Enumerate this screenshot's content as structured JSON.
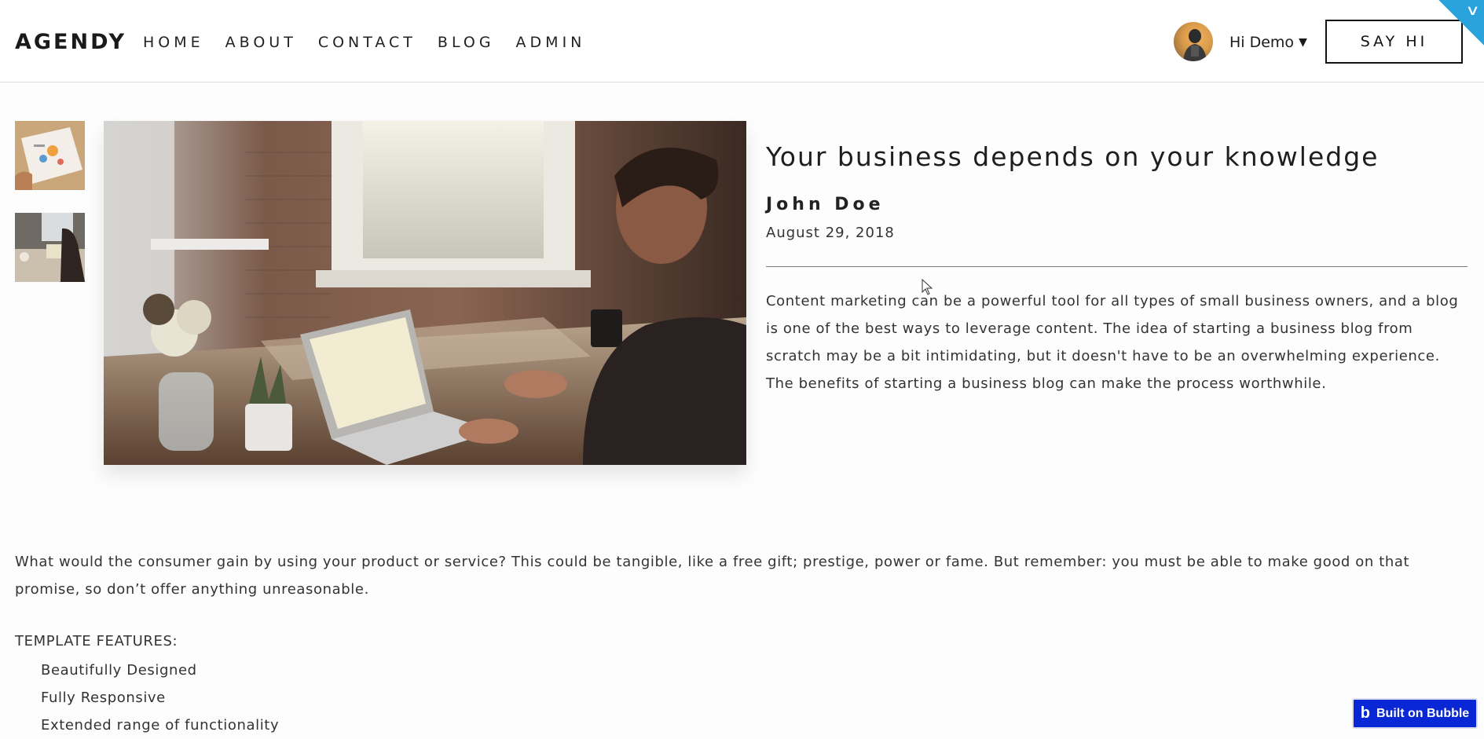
{
  "header": {
    "logo": "AGENDY",
    "nav": [
      {
        "label": "HOME"
      },
      {
        "label": "ABOUT"
      },
      {
        "label": "CONTACT"
      },
      {
        "label": "BLOG"
      },
      {
        "label": "ADMIN"
      }
    ],
    "user_greeting": "Hi Demo",
    "cta_label": "SAY HI"
  },
  "article": {
    "title": "Your business depends on your knowledge",
    "author": "John Doe",
    "date": "August 29, 2018",
    "summary": "Content marketing can be a powerful tool for all types of small business owners, and a blog is one of the best ways to leverage content. The idea of starting a business blog from scratch may be a bit intimidating, but it doesn't have to be an overwhelming experience. The benefits of starting a business blog can make the process worthwhile.",
    "body": "What would the consumer gain by using your product or service? This could be tangible, like a free gift; prestige, power or fame. But remember: you must be able to make good on that promise, so don’t offer anything unreasonable.",
    "features_heading": "TEMPLATE FEATURES:",
    "features": [
      "Beautifully Designed",
      "Fully Responsive",
      "Extended range of functionality"
    ]
  },
  "badge": {
    "label": "Built on Bubble"
  },
  "icons": {
    "caret": "caret-down-icon",
    "corner": "chevron-down-icon",
    "bubble": "bubble-logo-icon",
    "cursor": "mouse-cursor-icon"
  },
  "colors": {
    "accent_corner": "#2aa3dc",
    "badge_bg": "#0a27d6"
  }
}
